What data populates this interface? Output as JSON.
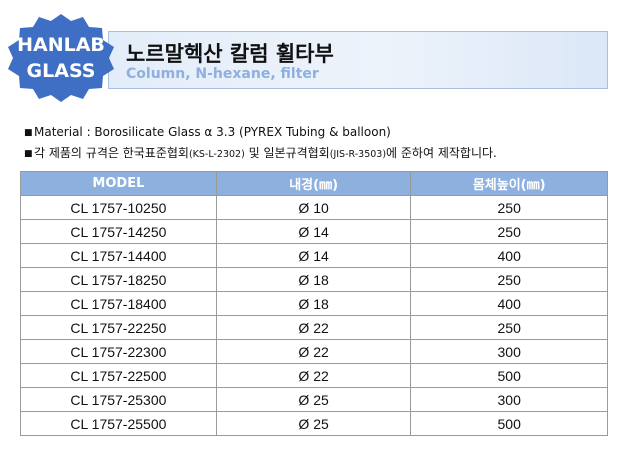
{
  "logo": {
    "line1": "HANLAB",
    "line2": "GLASS",
    "color": "#3f6fc4"
  },
  "header": {
    "title_ko": "노르말헥산 칼럼 휠타부",
    "title_en": "Column, N-hexane, filter"
  },
  "notes": {
    "material": "Material   : Borosilicate  Glass  α 3.3 (PYREX Tubing  & balloon)",
    "standard_a": "각 제품의 규격은 한국표준협회",
    "standard_b": "(KS-L-2302)",
    "standard_c": " 및 일본규격협회",
    "standard_d": "(JIS-R-3503)",
    "standard_e": "에 준하여 제작합니다."
  },
  "table": {
    "headers": [
      "MODEL",
      "내경(㎜)",
      "몸체높이(㎜)"
    ],
    "rows": [
      [
        "CL 1757-10250",
        "Ø 10",
        "250"
      ],
      [
        "CL 1757-14250",
        "Ø 14",
        "250"
      ],
      [
        "CL 1757-14400",
        "Ø 14",
        "400"
      ],
      [
        "CL 1757-18250",
        "Ø 18",
        "250"
      ],
      [
        "CL 1757-18400",
        "Ø 18",
        "400"
      ],
      [
        "CL 1757-22250",
        "Ø 22",
        "250"
      ],
      [
        "CL 1757-22300",
        "Ø 22",
        "300"
      ],
      [
        "CL 1757-22500",
        "Ø 22",
        "500"
      ],
      [
        "CL 1757-25300",
        "Ø 25",
        "300"
      ],
      [
        "CL 1757-25500",
        "Ø 25",
        "500"
      ]
    ]
  }
}
